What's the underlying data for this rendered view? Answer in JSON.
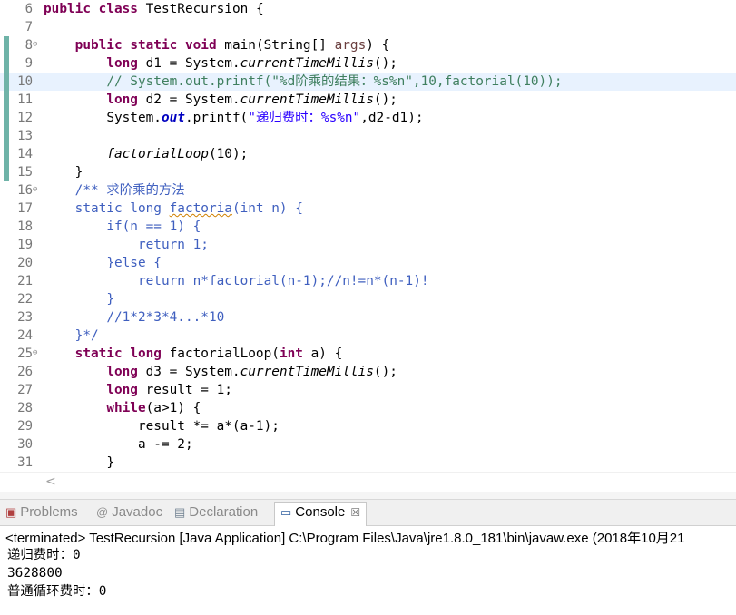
{
  "editor": {
    "l6": {
      "num": "6",
      "kw1": "public",
      "kw2": "class",
      "rest": " TestRecursion {"
    },
    "l7": {
      "num": "7"
    },
    "l8": {
      "num": "8",
      "kw1": "public",
      "kw2": "static",
      "kw3": "void",
      "pre": " main(String[] ",
      "args": "args",
      "post": ") {"
    },
    "l9": {
      "num": "9",
      "kw": "long",
      "a": " d1 = System.",
      "m": "currentTimeMillis",
      "b": "();"
    },
    "l10": {
      "num": "10",
      "comment": "// System.out.printf(\"%d阶乘的结果：%s%n\",10,factorial(10));"
    },
    "l11": {
      "num": "11",
      "kw": "long",
      "a": " d2 = System.",
      "m": "currentTimeMillis",
      "b": "();"
    },
    "l12": {
      "num": "12",
      "a": "System.",
      "out": "out",
      "b": ".printf(",
      "str": "\"递归费时：%s%n\"",
      "c": ",d2-d1);"
    },
    "l13": {
      "num": "13"
    },
    "l14": {
      "num": "14",
      "m": "factorialLoop",
      "b": "(10);"
    },
    "l15": {
      "num": "15",
      "t": "}"
    },
    "l16": {
      "num": "16",
      "comment": "/** 求阶乘的方法"
    },
    "l17": {
      "num": "17",
      "c1": "static long ",
      "sq": "factoria",
      "c2": "(int n) {"
    },
    "l18": {
      "num": "18",
      "c": "if(n == 1) {"
    },
    "l19": {
      "num": "19",
      "c": "return 1;"
    },
    "l20": {
      "num": "20",
      "c": "}else {"
    },
    "l21": {
      "num": "21",
      "c": "return n*factorial(n-1);//n!=n*(n-1)!"
    },
    "l22": {
      "num": "22",
      "c": "}"
    },
    "l23": {
      "num": "23",
      "c": "//1*2*3*4...*10"
    },
    "l24": {
      "num": "24",
      "c": "}*/"
    },
    "l25": {
      "num": "25",
      "kw1": "static",
      "kw2": "long",
      "a": " factorialLoop(",
      "kw3": "int",
      "b": " a) {"
    },
    "l26": {
      "num": "26",
      "kw": "long",
      "a": " d3 = System.",
      "m": "currentTimeMillis",
      "b": "();"
    },
    "l27": {
      "num": "27",
      "kw": "long",
      "a": " result = 1;"
    },
    "l28": {
      "num": "28",
      "kw": "while",
      "a": "(a>1) {"
    },
    "l29": {
      "num": "29",
      "a": "result *= a*(a-1);"
    },
    "l30": {
      "num": "30",
      "a": "a -= 2;"
    },
    "l31": {
      "num": "31",
      "a": "}"
    }
  },
  "scroll": {
    "left_arrow": "<"
  },
  "tabs": {
    "problems": "Problems",
    "javadoc": "Javadoc",
    "declaration": "Declaration",
    "console": "Console",
    "console_close": "☒"
  },
  "console": {
    "terminated": "<terminated> TestRecursion [Java Application] C:\\Program Files\\Java\\jre1.8.0_181\\bin\\javaw.exe (2018年10月21",
    "out1": "递归费时：0",
    "out2": "3628800",
    "out3": "普通循环费时：0"
  },
  "icons": {
    "fold": "⊖",
    "problems": "problems-icon",
    "javadoc": "at-icon",
    "declaration": "declaration-icon",
    "console": "console-icon"
  }
}
